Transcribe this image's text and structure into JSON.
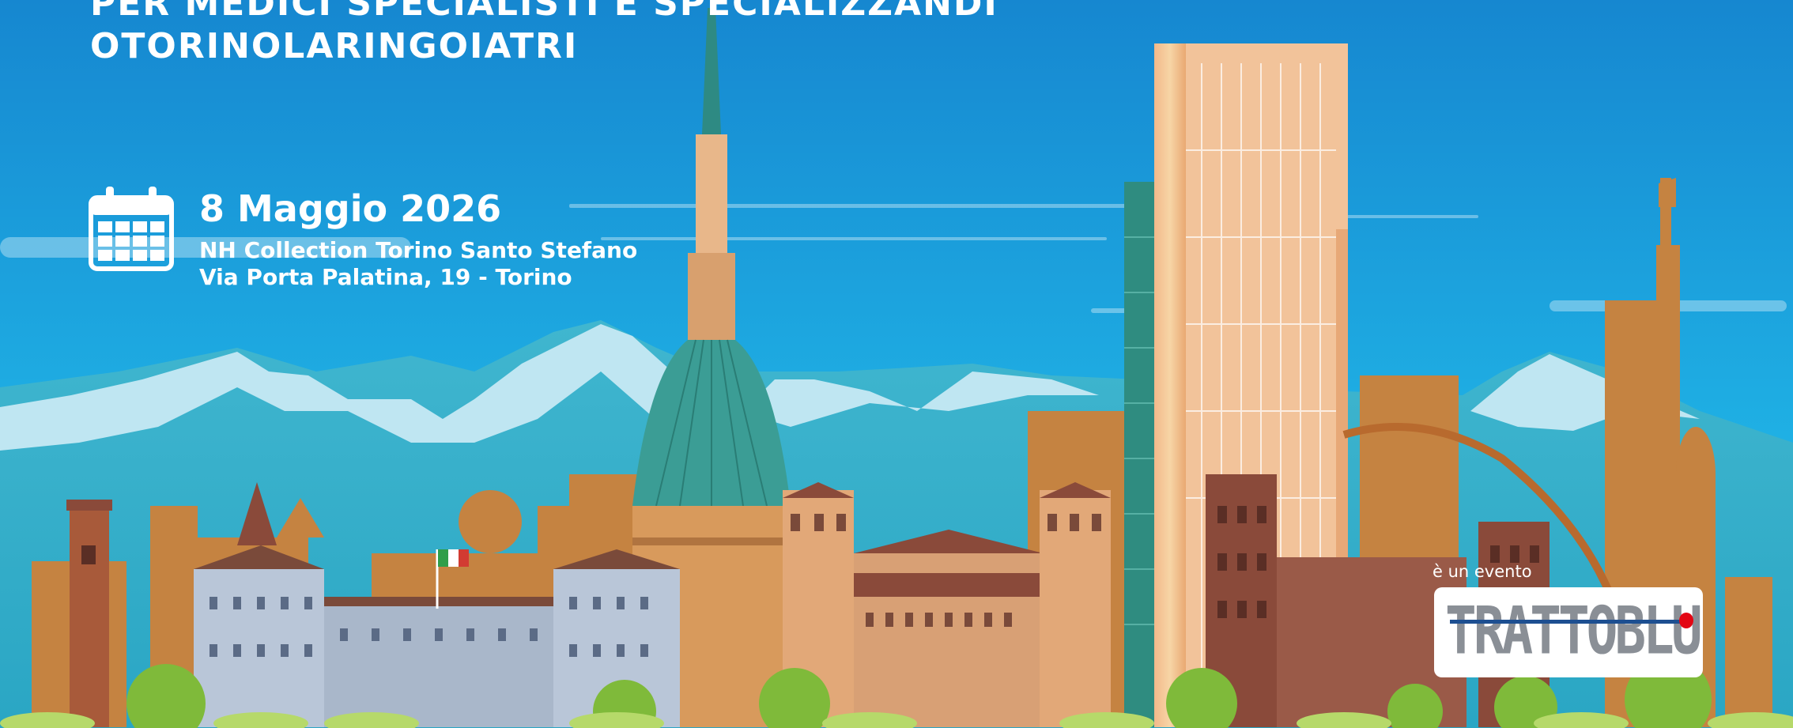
{
  "headline": {
    "line1": "PER MEDICI SPECIALISTI E SPECIALIZZANDI",
    "line2": "OTORINOLARINGOIATRI"
  },
  "event": {
    "date": "8 Maggio 2026",
    "venue": "NH Collection Torino Santo Stefano",
    "address": "Via Porta Palatina, 19 - Torino"
  },
  "organizer": {
    "label": "è un evento",
    "logo_text": "TRATTOBLU"
  },
  "icons": {
    "calendar": "calendar-icon"
  },
  "colors": {
    "sky_top": "#1687d0",
    "sky_bottom": "#27c0ea",
    "mountain": "#3fb8cf",
    "snow": "#bfe6f2",
    "brick": "#c58341",
    "brick_dark": "#8a4a3a",
    "palazzo": "#b9c6d8",
    "mole_dome": "#3b9d95",
    "tower_glass": "#2f8c80",
    "tree": "#7fba3a",
    "logo_blue": "#1d4f91",
    "logo_red": "#e30613",
    "logo_grey": "#8a8f96"
  }
}
